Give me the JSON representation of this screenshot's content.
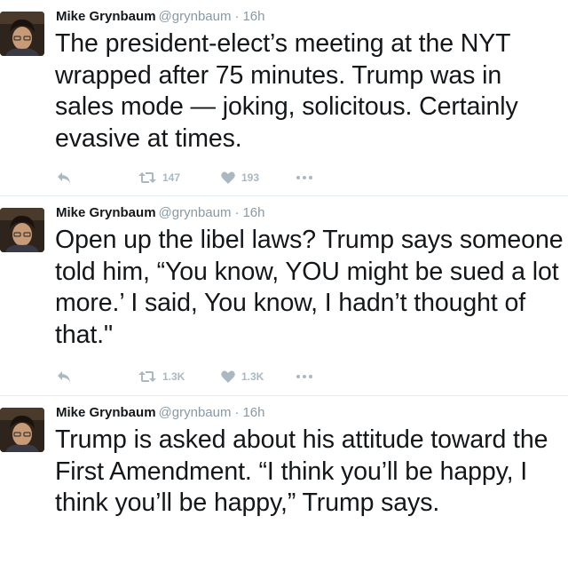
{
  "colors": {
    "name": "#14171a",
    "meta": "#8899a6",
    "action_icon": "#aab8c2",
    "divider": "#e6ecf0"
  },
  "icons": {
    "reply": "reply-icon",
    "retweet": "retweet-icon",
    "like": "heart-icon",
    "more": "more-icon"
  },
  "tweets": [
    {
      "author_name": "Mike Grynbaum",
      "handle": "@grynbaum",
      "separator": "·",
      "time": "16h",
      "text": "The president-elect’s meeting at the NYT wrapped after 75 minutes. Trump was in sales mode — joking, solicitous. Certainly evasive at times.",
      "retweets": "147",
      "likes": "193"
    },
    {
      "author_name": "Mike Grynbaum",
      "handle": "@grynbaum",
      "separator": "·",
      "time": "16h",
      "text": "Open up the libel laws? Trump says someone told him, “You know, YOU might be sued a lot more.’ I said, You know, I hadn’t thought of that.\"",
      "retweets": "1.3K",
      "likes": "1.3K"
    },
    {
      "author_name": "Mike Grynbaum",
      "handle": "@grynbaum",
      "separator": "·",
      "time": "16h",
      "text": "Trump is asked about his attitude toward the First Amendment. “I think you’ll be happy, I think you’ll be happy,” Trump says."
    }
  ]
}
